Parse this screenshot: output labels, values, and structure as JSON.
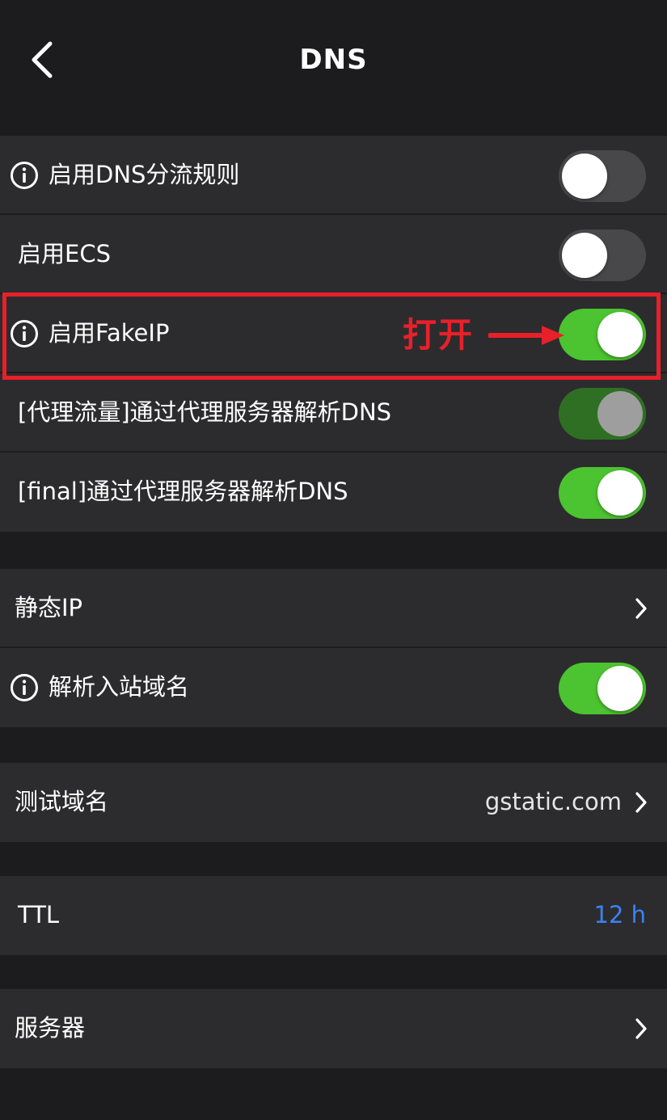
{
  "header": {
    "title": "DNS"
  },
  "groups": [
    {
      "rows": [
        {
          "label": "启用DNS分流规则",
          "info": true,
          "toggle": "off"
        },
        {
          "label": "启用ECS",
          "info": false,
          "toggle": "off"
        },
        {
          "label": "启用FakeIP",
          "info": true,
          "toggle": "on"
        },
        {
          "label": "[代理流量]通过代理服务器解析DNS",
          "info": false,
          "toggle": "on-disabled"
        },
        {
          "label": "[final]通过代理服务器解析DNS",
          "info": false,
          "toggle": "on"
        }
      ]
    },
    {
      "rows": [
        {
          "label": "静态IP",
          "chevron": true
        },
        {
          "label": "解析入站域名",
          "info": true,
          "toggle": "on"
        }
      ]
    },
    {
      "rows": [
        {
          "label": "测试域名",
          "value": "gstatic.com",
          "chevron": true
        }
      ]
    },
    {
      "rows": [
        {
          "label": "TTL",
          "value": "12 h",
          "value_color": "#3b82f6"
        }
      ]
    },
    {
      "rows": [
        {
          "label": "服务器",
          "chevron": true
        }
      ]
    }
  ],
  "annotation": {
    "text": "打开",
    "color": "#e8202a"
  },
  "colors": {
    "background": "#1c1c1e",
    "row_background": "#2c2c2e",
    "toggle_on": "#4cc330",
    "toggle_off": "#48484a",
    "toggle_disabled": "#2f6f23",
    "accent_blue": "#3b82f6"
  },
  "icons": [
    "back-chevron-icon",
    "info-icon",
    "chevron-right-icon",
    "arrow-right-icon"
  ]
}
